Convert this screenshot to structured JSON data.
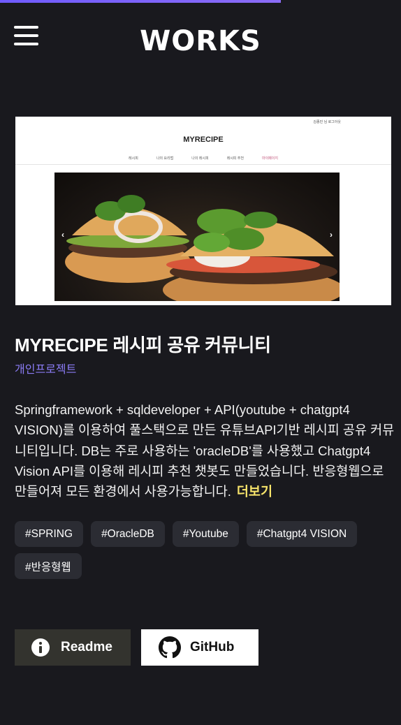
{
  "progress": {
    "percent": 70,
    "color": "#7b61ff"
  },
  "header": {
    "logo": "WORKS",
    "menu_icon": "hamburger-icon"
  },
  "screenshot": {
    "title": "MYRECIPE",
    "nav": [
      "레시피",
      "나의 요리법",
      "나의 레시피",
      "레시피 추천",
      "마이페이지"
    ],
    "login_text": "김종민 님   로그아웃",
    "prev": "‹",
    "next": "›"
  },
  "project": {
    "title": "MYRECIPE 레시피 공유 커뮤니티",
    "category": "개인프로젝트",
    "description": "Springframework + sqldeveloper + API(youtube + chatgpt4 VISION)를 이용하여 풀스택으로 만든 유튜브API기반 레시피 공유 커뮤니티입니다. DB는 주로 사용하는 'oracleDB'를 사용했고 Chatgpt4 Vision API를 이용해 레시피 추천 챗봇도 만들었습니다. 반응형웹으로 만들어져 모든 환경에서 사용가능합니다.",
    "more_label": "더보기"
  },
  "tags": [
    "#SPRING",
    "#OracleDB",
    "#Youtube",
    "#Chatgpt4 VISION",
    "#반응형웹"
  ],
  "buttons": {
    "readme": {
      "label": "Readme",
      "icon": "info-icon"
    },
    "github": {
      "label": "GitHub",
      "icon": "github-icon"
    }
  }
}
